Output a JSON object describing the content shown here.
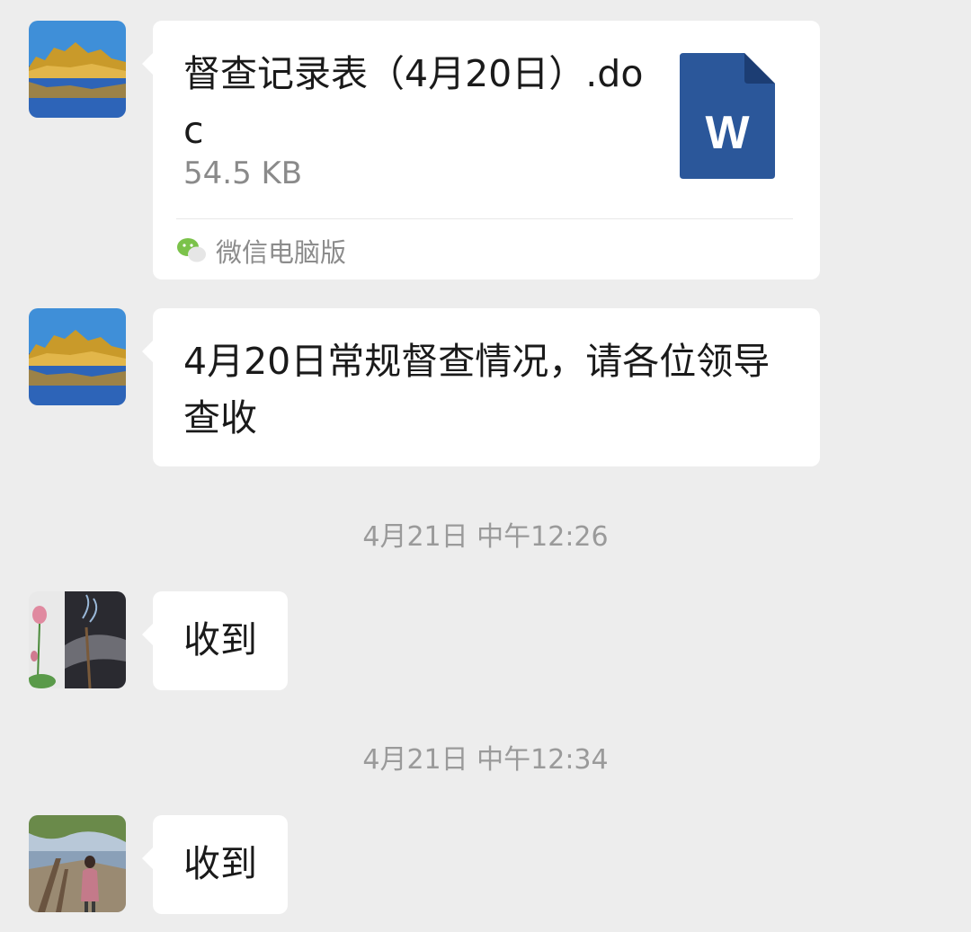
{
  "messages": [
    {
      "type": "file",
      "file_name": "督查记录表（4月20日）.doc",
      "file_size": "54.5 KB",
      "file_icon_letter": "W",
      "file_icon": "word-document-icon",
      "source_icon": "wechat-icon",
      "source_label": "微信电脑版"
    },
    {
      "type": "text",
      "text": "4月20日常规督查情况，请各位领导查收"
    },
    {
      "type": "text",
      "text": "收到"
    },
    {
      "type": "text",
      "text": "收到"
    }
  ],
  "timestamps": [
    "4月21日 中午12:26",
    "4月21日 中午12:34"
  ],
  "colors": {
    "background": "#ededed",
    "bubble": "#ffffff",
    "word_blue": "#2b579a",
    "wechat_green": "#7bc24a",
    "muted_text": "#8a8a8a"
  }
}
